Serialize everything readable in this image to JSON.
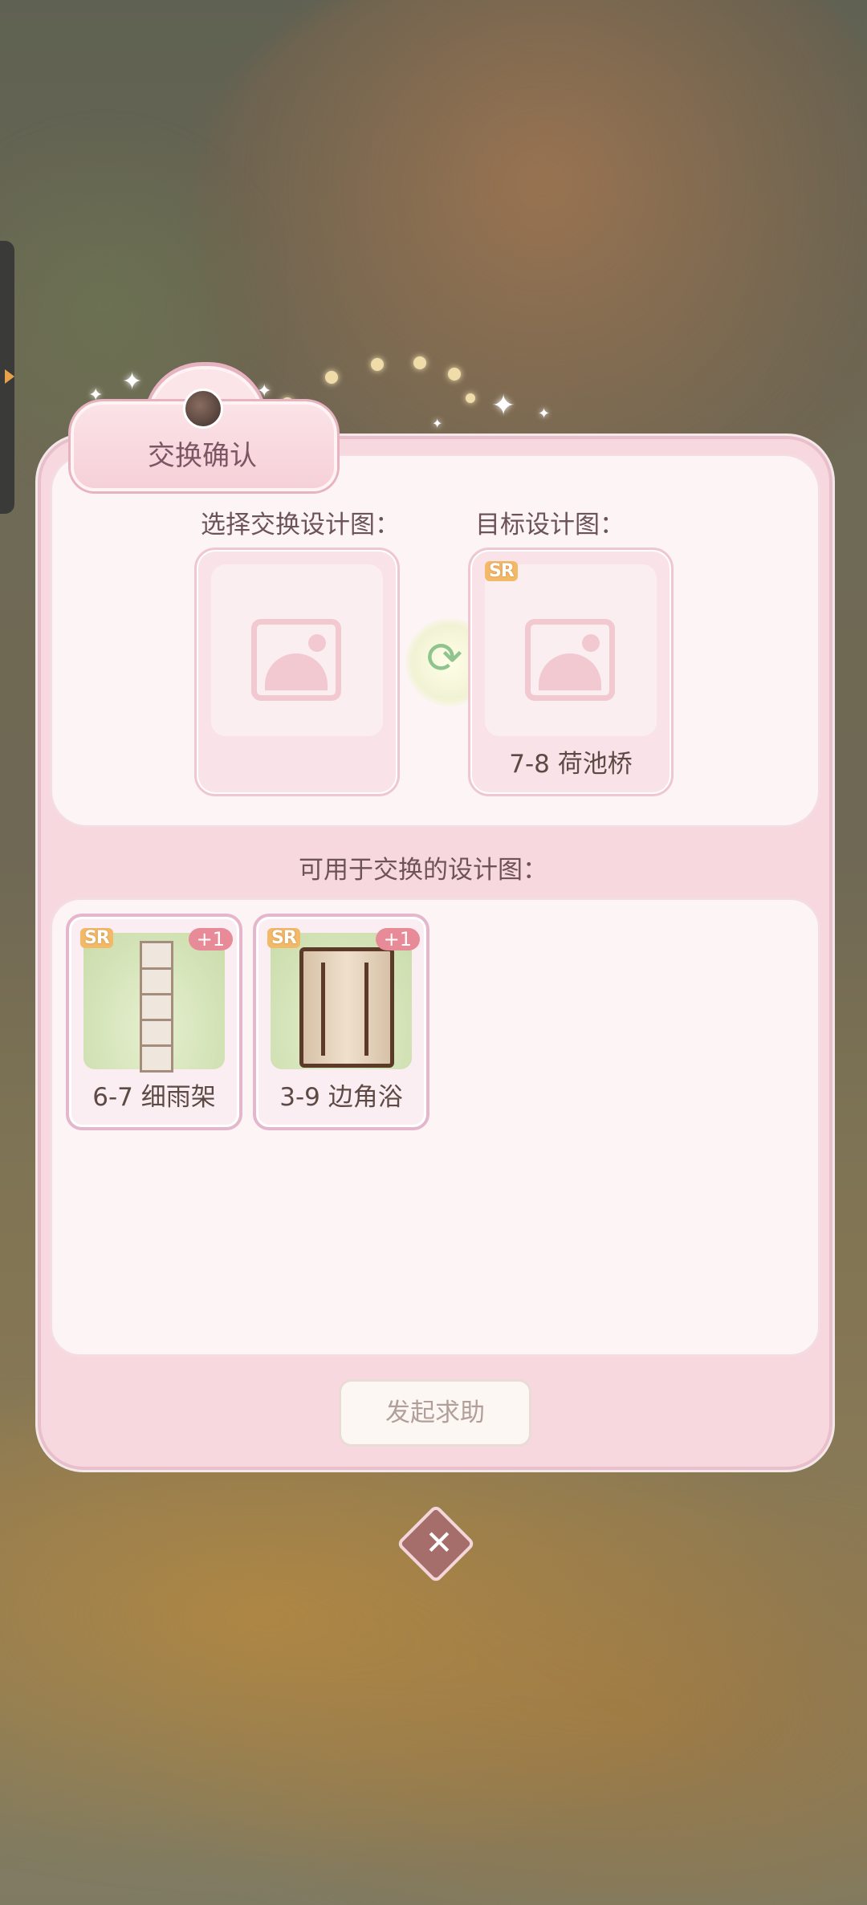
{
  "dialog": {
    "title": "交换确认",
    "select_label": "选择交换设计图：",
    "target_label": "目标设计图：",
    "available_label": "可用于交换的设计图：",
    "action_button": "发起求助",
    "close_icon": "close-icon"
  },
  "target": {
    "rarity": "SR",
    "name": "7-8 荷池桥"
  },
  "available_items": [
    {
      "rarity": "SR",
      "count": "+1",
      "name": "6-7 细雨架"
    },
    {
      "rarity": "SR",
      "count": "+1",
      "name": "3-9 边角浴"
    }
  ],
  "colors": {
    "panel": "#f6d8de",
    "accent": "#e88b98",
    "sr_badge": "#f2b968"
  }
}
